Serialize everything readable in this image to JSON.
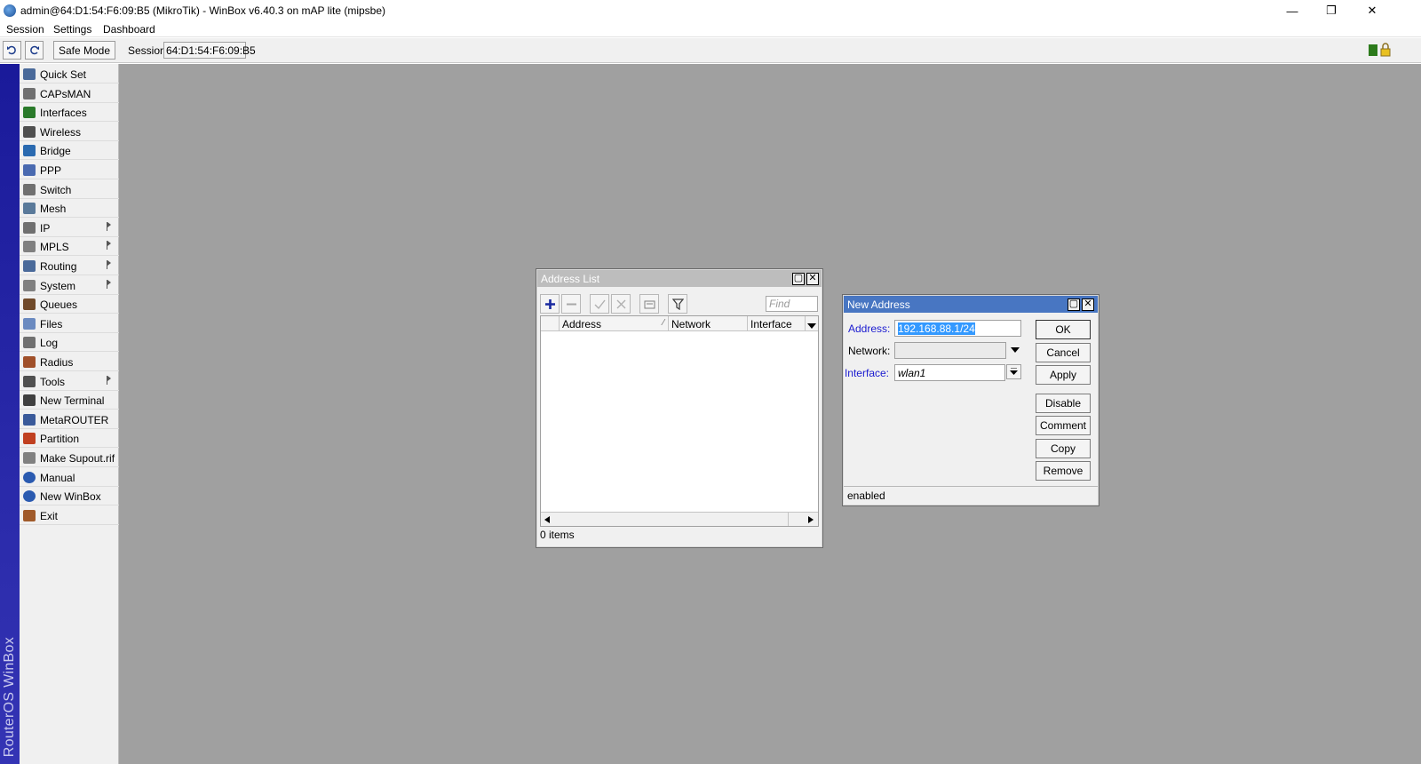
{
  "window": {
    "title": "admin@64:D1:54:F6:09:B5 (MikroTik) - WinBox v6.40.3 on mAP lite (mipsbe)",
    "minimize": "—",
    "restore": "❐",
    "close": "✕"
  },
  "menu": [
    "Session",
    "Settings",
    "Dashboard"
  ],
  "toolbar": {
    "safe_mode": "Safe Mode",
    "session_label": "Session:",
    "session_value": "64:D1:54:F6:09:B5"
  },
  "brand_vertical": "RouterOS WinBox",
  "sidebar": {
    "items": [
      {
        "label": "Quick Set",
        "icon": "quick-set-icon",
        "submenu": false
      },
      {
        "label": "CAPsMAN",
        "icon": "capsman-icon",
        "submenu": false
      },
      {
        "label": "Interfaces",
        "icon": "interfaces-icon",
        "submenu": false
      },
      {
        "label": "Wireless",
        "icon": "wireless-icon",
        "submenu": false
      },
      {
        "label": "Bridge",
        "icon": "bridge-icon",
        "submenu": false
      },
      {
        "label": "PPP",
        "icon": "ppp-icon",
        "submenu": false
      },
      {
        "label": "Switch",
        "icon": "switch-icon",
        "submenu": false
      },
      {
        "label": "Mesh",
        "icon": "mesh-icon",
        "submenu": false
      },
      {
        "label": "IP",
        "icon": "ip-icon",
        "submenu": true
      },
      {
        "label": "MPLS",
        "icon": "mpls-icon",
        "submenu": true
      },
      {
        "label": "Routing",
        "icon": "routing-icon",
        "submenu": true
      },
      {
        "label": "System",
        "icon": "system-icon",
        "submenu": true
      },
      {
        "label": "Queues",
        "icon": "queues-icon",
        "submenu": false
      },
      {
        "label": "Files",
        "icon": "files-icon",
        "submenu": false
      },
      {
        "label": "Log",
        "icon": "log-icon",
        "submenu": false
      },
      {
        "label": "Radius",
        "icon": "radius-icon",
        "submenu": false
      },
      {
        "label": "Tools",
        "icon": "tools-icon",
        "submenu": true
      },
      {
        "label": "New Terminal",
        "icon": "terminal-icon",
        "submenu": false
      },
      {
        "label": "MetaROUTER",
        "icon": "metarouter-icon",
        "submenu": false
      },
      {
        "label": "Partition",
        "icon": "partition-icon",
        "submenu": false
      },
      {
        "label": "Make Supout.rif",
        "icon": "supout-icon",
        "submenu": false
      },
      {
        "label": "Manual",
        "icon": "manual-icon",
        "submenu": false
      },
      {
        "label": "New WinBox",
        "icon": "winbox-icon",
        "submenu": false
      },
      {
        "label": "Exit",
        "icon": "exit-icon",
        "submenu": false
      }
    ]
  },
  "address_list": {
    "title": "Address List",
    "find_placeholder": "Find",
    "columns": [
      "Address",
      "Network",
      "Interface"
    ],
    "status": "0 items"
  },
  "new_address": {
    "title": "New Address",
    "address_label": "Address:",
    "address_value": "192.168.88.1/24",
    "network_label": "Network:",
    "network_value": "",
    "interface_label": "Interface:",
    "interface_value": "wlan1",
    "buttons": [
      "OK",
      "Cancel",
      "Apply",
      "Disable",
      "Comment",
      "Copy",
      "Remove"
    ],
    "status": "enabled"
  },
  "colors": {
    "workspace": "#a0a0a0",
    "side_strip": "#22229f",
    "inactive_title": "#bdbdbd",
    "active_title": "#4876c2",
    "label_blue": "#1a1ad0"
  }
}
